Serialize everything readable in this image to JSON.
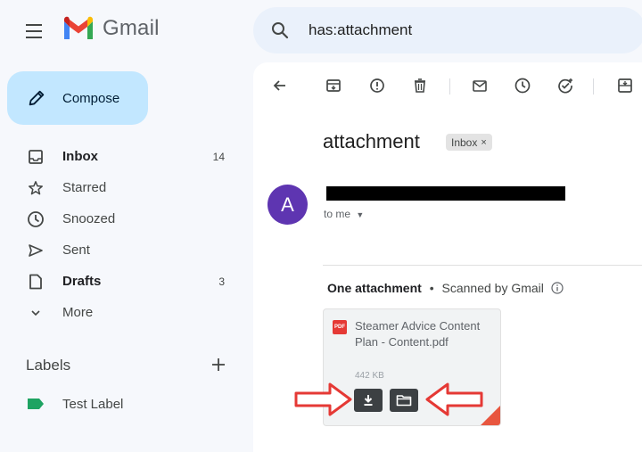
{
  "header": {
    "app_name": "Gmail",
    "search_query": "has:attachment"
  },
  "sidebar": {
    "compose_label": "Compose",
    "items": [
      {
        "label": "Inbox",
        "count": "14",
        "bold": true,
        "icon": "inbox-icon"
      },
      {
        "label": "Starred",
        "count": "",
        "bold": false,
        "icon": "star-icon"
      },
      {
        "label": "Snoozed",
        "count": "",
        "bold": false,
        "icon": "clock-icon"
      },
      {
        "label": "Sent",
        "count": "",
        "bold": false,
        "icon": "send-icon"
      },
      {
        "label": "Drafts",
        "count": "3",
        "bold": true,
        "icon": "file-icon"
      },
      {
        "label": "More",
        "count": "",
        "bold": false,
        "icon": "chevron-down-icon"
      }
    ],
    "labels_heading": "Labels",
    "labels": [
      {
        "label": "Test Label",
        "color": "#1ea362"
      }
    ]
  },
  "message": {
    "subject": "attachment",
    "chip": "Inbox",
    "avatar_letter": "A",
    "avatar_color": "#5e35b1",
    "recipient": "to me",
    "attachment_count_text": "One attachment",
    "separator": "•",
    "scan_text": "Scanned by Gmail",
    "attachment": {
      "file_name": "Steamer Advice Content Plan - Content.pdf",
      "file_size": "442 KB",
      "type_badge": "PDF"
    }
  },
  "colors": {
    "compose_bg": "#c2e7ff",
    "search_bg": "#eaf1fb",
    "annotation_arrow": "#e53935"
  }
}
